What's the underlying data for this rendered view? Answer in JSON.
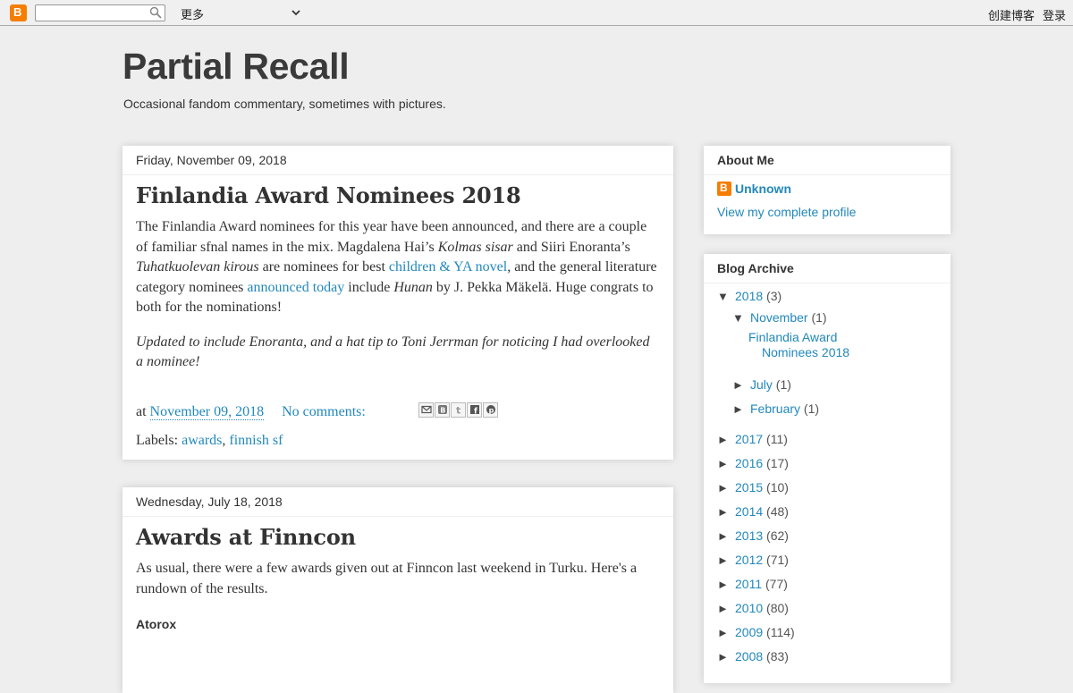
{
  "navbar": {
    "search_placeholder": "",
    "more": "更多",
    "create_blog": "创建博客",
    "sign_in": "登录"
  },
  "blog": {
    "title": "Partial Recall",
    "description": "Occasional fandom commentary, sometimes with pictures."
  },
  "posts": [
    {
      "date": "Friday, November 09, 2018",
      "title": "Finlandia Award Nominees 2018",
      "p1_a": "The Finlandia Award nominees for this year have been announced, and there are a couple of familiar sfnal names in the mix. Magdalena Hai’s ",
      "p1_em1": "Kolmas sisar",
      "p1_b": " and Siiri Enoranta’s ",
      "p1_em2": "Tuhatkuolevan kirous",
      "p1_c": " are nominees for best ",
      "p1_link1": "children & YA novel",
      "p1_d": ", and the general literature category nominees ",
      "p1_link2": "announced today",
      "p1_e": " include ",
      "p1_em3": "Hunan",
      "p1_f": " by J. Pekka Mäkelä. Huge congrats to both for the nominations!",
      "p2": "Updated to include Enoranta, and a hat tip to Toni Jerrman for noticing I had overlooked a nominee!",
      "at": "at",
      "timestamp": "November 09, 2018",
      "comments": "No comments:",
      "labels_prefix": "Labels:",
      "labels": [
        "awards",
        "finnish sf"
      ]
    },
    {
      "date": "Wednesday, July 18, 2018",
      "title": "Awards at Finncon",
      "p1": "As usual, there were a few awards given out at Finncon last weekend in Turku. Here's a rundown of the results.",
      "subheading": "Atorox"
    }
  ],
  "sidebar": {
    "about": {
      "title": "About Me",
      "name": "Unknown",
      "profile_link": "View my complete profile"
    },
    "archive": {
      "title": "Blog Archive",
      "expanded_year": {
        "year": "2018",
        "count": "(3)",
        "toggle": "▼"
      },
      "expanded_month": {
        "month": "November",
        "count": "(1)",
        "toggle": "▼"
      },
      "post_link": "Finlandia Award Nominees 2018",
      "months": [
        {
          "month": "July",
          "count": "(1)",
          "toggle": "►"
        },
        {
          "month": "February",
          "count": "(1)",
          "toggle": "►"
        }
      ],
      "years": [
        {
          "year": "2017",
          "count": "(11)",
          "toggle": "►"
        },
        {
          "year": "2016",
          "count": "(17)",
          "toggle": "►"
        },
        {
          "year": "2015",
          "count": "(10)",
          "toggle": "►"
        },
        {
          "year": "2014",
          "count": "(48)",
          "toggle": "►"
        },
        {
          "year": "2013",
          "count": "(62)",
          "toggle": "►"
        },
        {
          "year": "2012",
          "count": "(71)",
          "toggle": "►"
        },
        {
          "year": "2011",
          "count": "(77)",
          "toggle": "►"
        },
        {
          "year": "2010",
          "count": "(80)",
          "toggle": "►"
        },
        {
          "year": "2009",
          "count": "(114)",
          "toggle": "►"
        },
        {
          "year": "2008",
          "count": "(83)",
          "toggle": "►"
        }
      ]
    }
  },
  "colors": {
    "accent_link": "#2288bb",
    "blogger_orange": "#f57d00",
    "background": "#eeeeee"
  }
}
